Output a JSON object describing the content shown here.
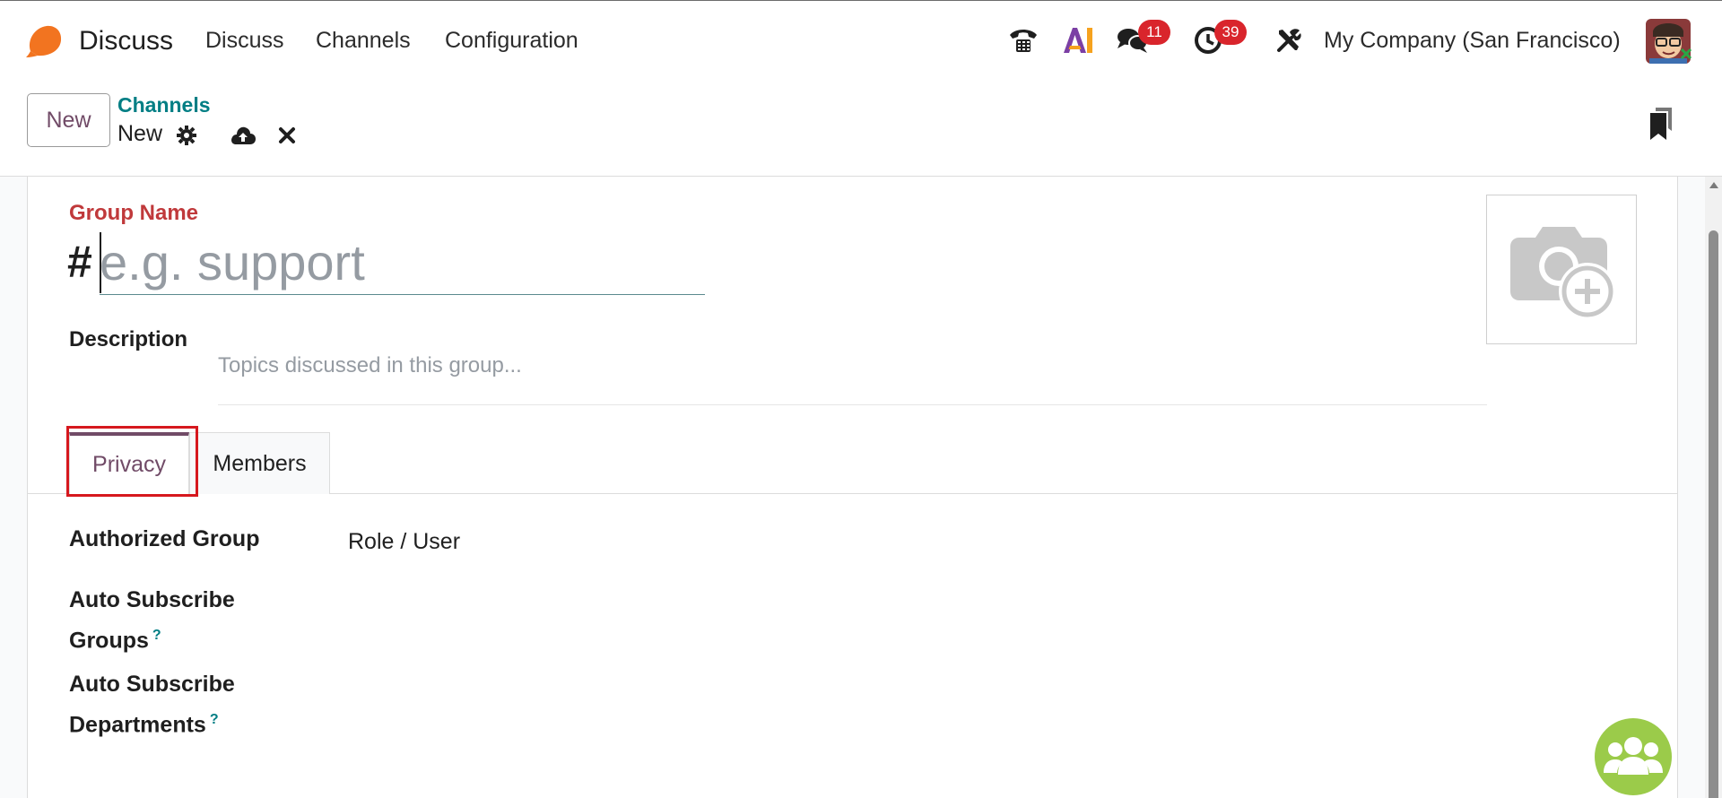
{
  "navbar": {
    "app_name": "Discuss",
    "menu": [
      "Discuss",
      "Channels",
      "Configuration"
    ],
    "messages_badge": "11",
    "activities_badge": "39",
    "company": "My Company (San Francisco)",
    "ai_label": "AI"
  },
  "control_panel": {
    "new_button": "New",
    "breadcrumb_parent": "Channels",
    "breadcrumb_current": "New"
  },
  "form": {
    "group_name_label": "Group Name",
    "hash": "#",
    "group_name_placeholder": "e.g. support",
    "description_label": "Description",
    "description_placeholder": "Topics discussed in this group..."
  },
  "tabs": [
    "Privacy",
    "Members"
  ],
  "privacy_fields": {
    "authorized_group_label": "Authorized Group",
    "authorized_group_value": "Role / User",
    "auto_subscribe_groups_label_1": "Auto Subscribe",
    "auto_subscribe_groups_label_2": "Groups",
    "auto_subscribe_departments_label_1": "Auto Subscribe",
    "auto_subscribe_departments_label_2": "Departments",
    "help_mark": "?"
  },
  "colors": {
    "brand": "#714b67",
    "link": "#017e84",
    "required_label": "#c0393b",
    "badge": "#d9252c",
    "highlight": "#d6181e"
  }
}
